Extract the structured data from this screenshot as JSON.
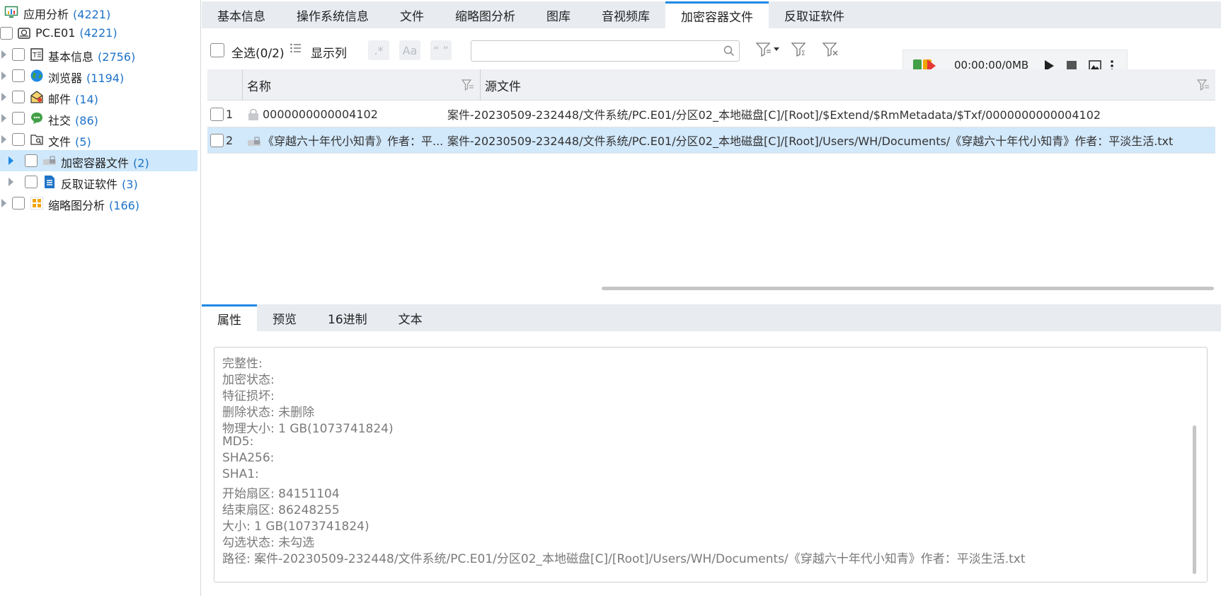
{
  "tree": {
    "root": {
      "label": "应用分析",
      "count": "(4221)"
    },
    "device": {
      "label": "PC.E01",
      "count": "(4221)"
    },
    "items": [
      {
        "label": "基本信息",
        "count": "(2756)"
      },
      {
        "label": "浏览器",
        "count": "(1194)"
      },
      {
        "label": "邮件",
        "count": "(14)"
      },
      {
        "label": "社交",
        "count": "(86)"
      },
      {
        "label": "文件",
        "count": "(5)"
      },
      {
        "label": "加密容器文件",
        "count": "(2)"
      },
      {
        "label": "反取证软件",
        "count": "(3)"
      },
      {
        "label": "缩略图分析",
        "count": "(166)"
      }
    ]
  },
  "top_tabs": [
    "基本信息",
    "操作系统信息",
    "文件",
    "缩略图分析",
    "图库",
    "音视频库",
    "加密容器文件",
    "反取证软件"
  ],
  "toolbar": {
    "select_all": "全选(0/2)",
    "show_columns": "显示列",
    "regex_btn": ".*",
    "case_btn": "Aa",
    "quote_btn": "“ ”",
    "search_placeholder": ""
  },
  "recorder": {
    "time": "00:00:00/0MB"
  },
  "grid": {
    "columns": [
      "名称",
      "源文件"
    ],
    "rows": [
      {
        "index": "1",
        "name": "0000000000004102",
        "source": "案件-20230509-232448/文件系统/PC.E01/分区02_本地磁盘[C]/[Root]/$Extend/$RmMetadata/$Txf/0000000000004102"
      },
      {
        "index": "2",
        "name": "《穿越六十年代小知青》作者：平...",
        "source": "案件-20230509-232448/文件系统/PC.E01/分区02_本地磁盘[C]/[Root]/Users/WH/Documents/《穿越六十年代小知青》作者：平淡生活.txt"
      }
    ]
  },
  "bottom_tabs": [
    "属性",
    "预览",
    "16进制",
    "文本"
  ],
  "properties": [
    "完整性:",
    "加密状态:",
    "特征损坏:",
    "删除状态: 未删除",
    "物理大小: 1 GB(1073741824)",
    "MD5:",
    "SHA256:",
    "SHA1:",
    "开始扇区: 84151104",
    "结束扇区: 86248255",
    "大小: 1 GB(1073741824)",
    "勾选状态: 未勾选",
    "路径: 案件-20230509-232448/文件系统/PC.E01/分区02_本地磁盘[C]/[Root]/Users/WH/Documents/《穿越六十年代小知青》作者：平淡生活.txt"
  ],
  "colors": {
    "accent": "#1e88e5",
    "count": "#1e73c8",
    "selection": "#cfe8fb"
  }
}
